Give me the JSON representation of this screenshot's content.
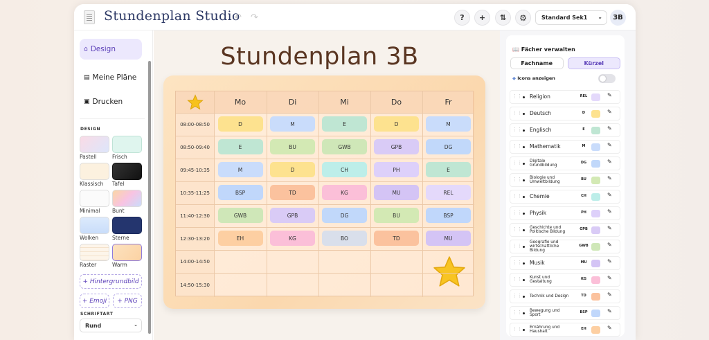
{
  "header": {
    "app_title": "Stundenplan Studio",
    "undo_icon": "↶",
    "redo_icon": "↷",
    "help": "?",
    "add": "+",
    "sort_icon": "⇅",
    "settings_icon": "⚙",
    "preset": "Standard Sek1",
    "class_badge": "3B"
  },
  "sidebar": {
    "nav": [
      {
        "label": "Design",
        "icon": "⌂"
      },
      {
        "label": "Meine Pläne",
        "icon": "▤"
      },
      {
        "label": "Drucken",
        "icon": "▣"
      }
    ],
    "design_label": "DESIGN",
    "themes": [
      {
        "label": "Pastell"
      },
      {
        "label": "Frisch"
      },
      {
        "label": "Klassisch"
      },
      {
        "label": "Tafel"
      },
      {
        "label": "Minimal"
      },
      {
        "label": "Bunt"
      },
      {
        "label": "Wolken"
      },
      {
        "label": "Sterne"
      },
      {
        "label": "Raster"
      },
      {
        "label": "Warm"
      }
    ],
    "selected_theme": "Warm",
    "add_background": "+ Hintergrundbild",
    "add_emoji": "+ Emoji",
    "add_png": "+ PNG",
    "font_label": "SCHRIFTART",
    "font_value": "Rund"
  },
  "plan": {
    "title": "Stundenplan 3B",
    "corner_icon": "star-icon",
    "days": [
      "Mo",
      "Di",
      "Mi",
      "Do",
      "Fr"
    ],
    "times": [
      "08:00-08:50",
      "08:50-09:40",
      "09:45-10:35",
      "10:35-11:25",
      "11:40-12:30",
      "12:30-13:20",
      "14:00-14:50",
      "14:50-15:30"
    ],
    "lessons": [
      [
        "D",
        "M",
        "E",
        "D",
        "M"
      ],
      [
        "E",
        "BU",
        "GWB",
        "GPB",
        "DG"
      ],
      [
        "M",
        "D",
        "CH",
        "PH",
        "E"
      ],
      [
        "BSP",
        "TD",
        "KG",
        "MU",
        "REL"
      ],
      [
        "GWB",
        "GPB",
        "DG",
        "BU",
        "BSP"
      ],
      [
        "EH",
        "KG",
        "BO",
        "TD",
        "MU"
      ],
      [
        "",
        "",
        "",
        "",
        ""
      ],
      [
        "",
        "",
        "",
        "",
        ""
      ]
    ]
  },
  "subjects_panel": {
    "title": "Fächer verwalten",
    "title_icon": "📖",
    "tabs": [
      "Fachname",
      "Kürzel"
    ],
    "active_tab": "Kürzel",
    "show_icons_label": "Icons anzeigen",
    "show_icons": false,
    "subjects": [
      {
        "name": "Religion",
        "abbr": "REL",
        "color": "#e4d9fb"
      },
      {
        "name": "Deutsch",
        "abbr": "D",
        "color": "#fde28f"
      },
      {
        "name": "Englisch",
        "abbr": "E",
        "color": "#bfe6d3"
      },
      {
        "name": "Mathematik",
        "abbr": "M",
        "color": "#c9dcfb"
      },
      {
        "name": "Digitale Grundbildung",
        "abbr": "DG",
        "color": "#c1d8fa"
      },
      {
        "name": "Biologie und Umweltbildung",
        "abbr": "BU",
        "color": "#d3e9b4"
      },
      {
        "name": "Chemie",
        "abbr": "CH",
        "color": "#bdeee9"
      },
      {
        "name": "Physik",
        "abbr": "PH",
        "color": "#ddd0fa"
      },
      {
        "name": "Geschichte und Politische Bildung",
        "abbr": "GPB",
        "color": "#d9cbf6"
      },
      {
        "name": "Geografie und wirtschaftliche Bildung",
        "abbr": "GWB",
        "color": "#cfe7b8"
      },
      {
        "name": "Musik",
        "abbr": "MU",
        "color": "#d4c4f5"
      },
      {
        "name": "Kunst und Gestaltung",
        "abbr": "KG",
        "color": "#fbbfd8"
      },
      {
        "name": "Technik und Design",
        "abbr": "TD",
        "color": "#fbc29e"
      },
      {
        "name": "Bewegung und Sport",
        "abbr": "BSP",
        "color": "#c0d7fb"
      },
      {
        "name": "Ernährung und Haushalt",
        "abbr": "EH",
        "color": "#fdcfa2"
      }
    ]
  },
  "colors": {
    "D": "#fde28f",
    "M": "#c9dcfb",
    "E": "#bfe6d3",
    "BU": "#d3e9b4",
    "GWB": "#cfe7b8",
    "GPB": "#d9cbf6",
    "DG": "#c1d8fa",
    "CH": "#bdeee9",
    "PH": "#ddd0fa",
    "BSP": "#c0d7fb",
    "TD": "#fbc29e",
    "KG": "#fbbfd8",
    "MU": "#d4c4f5",
    "REL": "#e4d9fb",
    "EH": "#fdcfa2",
    "BO": "#d9dfeb"
  }
}
